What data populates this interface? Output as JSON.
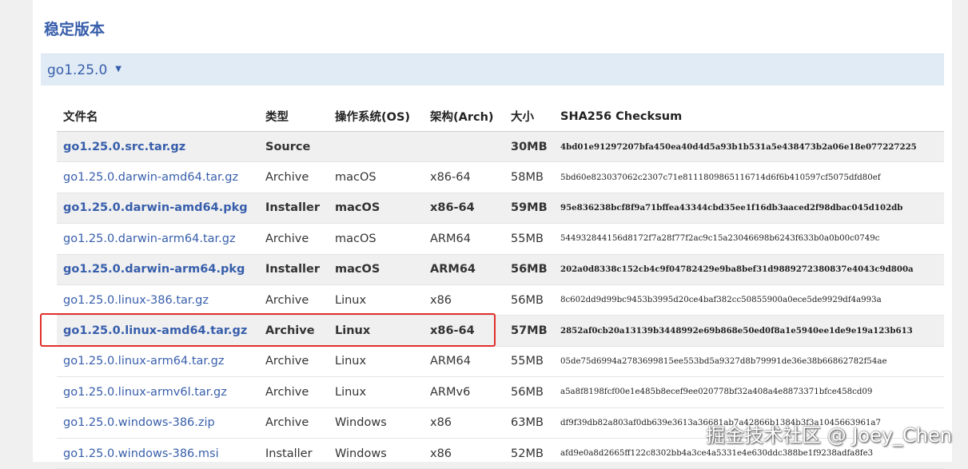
{
  "section": {
    "title": "稳定版本"
  },
  "version": {
    "label": "go1.25.0",
    "caret": "▼"
  },
  "table": {
    "headers": {
      "file": "文件名",
      "type": "类型",
      "os": "操作系统(OS)",
      "arch": "架构(Arch)",
      "size": "大小",
      "sha": "SHA256 Checksum"
    },
    "rows": [
      {
        "file": "go1.25.0.src.tar.gz",
        "type": "Source",
        "os": "",
        "arch": "",
        "size": "30MB",
        "sha": "4bd01e91297207bfa450ea40d4d5a93b1b531a5e438473b2a06e18e077227225",
        "highlight": true
      },
      {
        "file": "go1.25.0.darwin-amd64.tar.gz",
        "type": "Archive",
        "os": "macOS",
        "arch": "x86-64",
        "size": "58MB",
        "sha": "5bd60e823037062c2307c71e8111809865116714d6f6b410597cf5075dfd80ef",
        "highlight": false
      },
      {
        "file": "go1.25.0.darwin-amd64.pkg",
        "type": "Installer",
        "os": "macOS",
        "arch": "x86-64",
        "size": "59MB",
        "sha": "95e836238bcf8f9a71bffea43344cbd35ee1f16db3aaced2f98dbac045d102db",
        "highlight": true
      },
      {
        "file": "go1.25.0.darwin-arm64.tar.gz",
        "type": "Archive",
        "os": "macOS",
        "arch": "ARM64",
        "size": "55MB",
        "sha": "544932844156d8172f7a28f77f2ac9c15a23046698b6243f633b0a0b00c0749c",
        "highlight": false
      },
      {
        "file": "go1.25.0.darwin-arm64.pkg",
        "type": "Installer",
        "os": "macOS",
        "arch": "ARM64",
        "size": "56MB",
        "sha": "202a0d8338c152cb4c9f04782429e9ba8bef31d9889272380837e4043c9d800a",
        "highlight": true
      },
      {
        "file": "go1.25.0.linux-386.tar.gz",
        "type": "Archive",
        "os": "Linux",
        "arch": "x86",
        "size": "56MB",
        "sha": "8c602dd9d99bc9453b3995d20ce4baf382cc50855900a0ece5de9929df4a993a",
        "highlight": false
      },
      {
        "file": "go1.25.0.linux-amd64.tar.gz",
        "type": "Archive",
        "os": "Linux",
        "arch": "x86-64",
        "size": "57MB",
        "sha": "2852af0cb20a13139b3448992e69b868e50ed0f8a1e5940ee1de9e19a123b613",
        "highlight": true
      },
      {
        "file": "go1.25.0.linux-arm64.tar.gz",
        "type": "Archive",
        "os": "Linux",
        "arch": "ARM64",
        "size": "55MB",
        "sha": "05de75d6994a2783699815ee553bd5a9327d8b79991de36e38b66862782f54ae",
        "highlight": false
      },
      {
        "file": "go1.25.0.linux-armv6l.tar.gz",
        "type": "Archive",
        "os": "Linux",
        "arch": "ARMv6",
        "size": "56MB",
        "sha": "a5a8f8198fcf00e1e485b8ecef9ee020778bf32a408a4e8873371bfce458cd09",
        "highlight": false
      },
      {
        "file": "go1.25.0.windows-386.zip",
        "type": "Archive",
        "os": "Windows",
        "arch": "x86",
        "size": "63MB",
        "sha": "df9f39db82a803af0db639e3613a36681ab7a42866b1384b3f3a1045663961a7",
        "highlight": false
      },
      {
        "file": "go1.25.0.windows-386.msi",
        "type": "Installer",
        "os": "Windows",
        "arch": "x86",
        "size": "52MB",
        "sha": "afd9e0a8d2665ff122c8302bb4a3ce4a5331e4e630ddc388be1f9238adfa8fe3",
        "highlight": false
      }
    ]
  },
  "watermark": "掘金技术社区 @ Joey_Chen",
  "colors": {
    "link": "#375eab",
    "version_bar": "#e0ebf5",
    "highlight_row": "#f0f0f0",
    "annotation_box": "#e0302b"
  }
}
